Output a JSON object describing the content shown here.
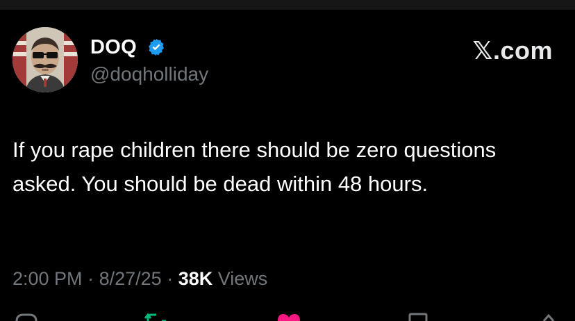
{
  "author": {
    "display_name": "DOQ",
    "handle": "@doqholliday",
    "verified": true
  },
  "brand": "𝕏.com",
  "tweet": {
    "text": "If you rape children there should be zero questions asked. You should be dead within 48 hours.",
    "time": "2:00 PM",
    "date": "8/27/25",
    "views_count": "38K",
    "views_label": "Views"
  },
  "colors": {
    "background": "#000000",
    "text": "#ffffff",
    "secondary_text": "#71767b",
    "verified_badge": "#1d9bf0",
    "repost_green": "#00ba7c",
    "like_pink": "#f91880"
  },
  "icons": {
    "verified": "verified-badge-icon",
    "reply": "reply-icon",
    "repost": "repost-icon",
    "like": "heart-icon",
    "bookmark": "bookmark-icon",
    "share": "share-icon"
  }
}
